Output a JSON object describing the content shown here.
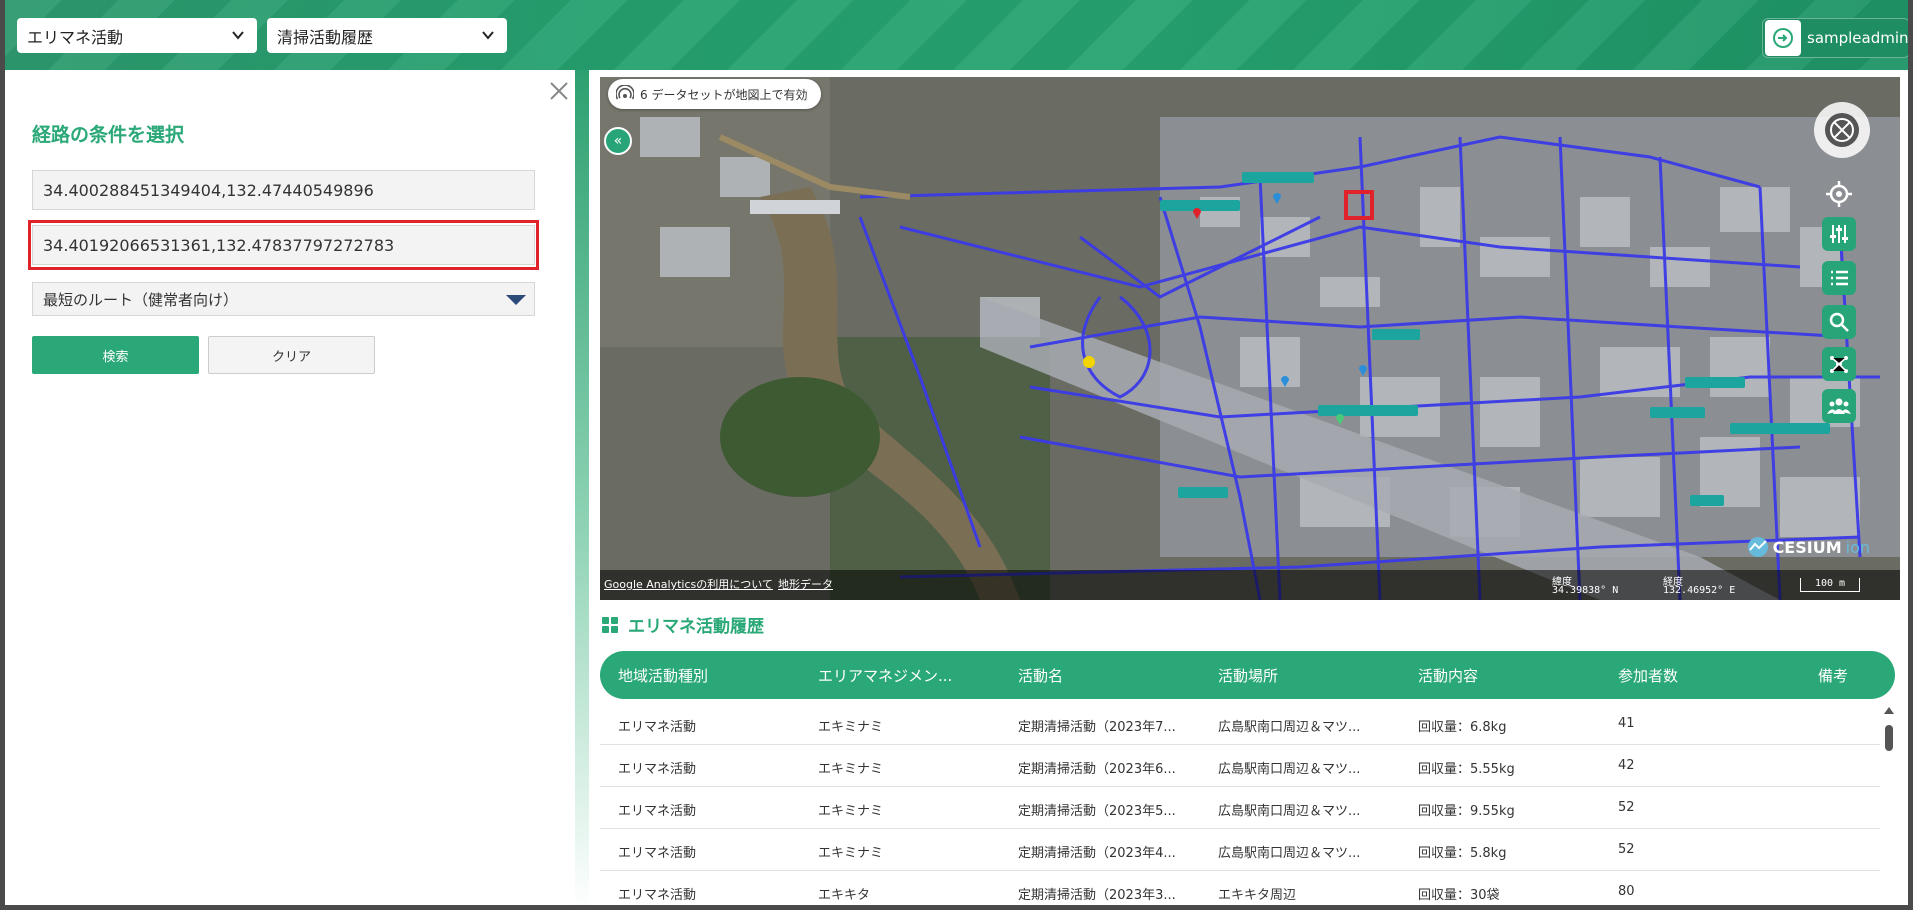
{
  "header": {
    "category_select": "エリマネ活動",
    "history_select": "清掃活動履歴",
    "user_name": "sampleadmin",
    "accent": "#2aa877"
  },
  "route_panel": {
    "title": "経路の条件を選択",
    "start_coord": "34.400288451349404,132.47440549896",
    "end_coord": "34.40192066531361,132.47837797272783",
    "route_type": "最短のルート（健常者向け）",
    "search_label": "検索",
    "clear_label": "クリア"
  },
  "map": {
    "dataset_notice": "6 データセットが地図上で有効",
    "footer_link_analytics": "Google Analyticsの利用について",
    "footer_link_terrain": "地形データ",
    "lat_label": "緯度",
    "lat_value": "34.39838° N",
    "lon_label": "経度",
    "lon_value": "132.46952° E",
    "scale": "100 m",
    "logo": "CESIUM",
    "logo_suffix": "ion"
  },
  "table": {
    "title": "エリマネ活動履歴",
    "columns": [
      "地域活動種別",
      "エリアマネジメン...",
      "活動名",
      "活動場所",
      "活動内容",
      "参加者数",
      "備考"
    ],
    "rows": [
      [
        "エリマネ活動",
        "エキミナミ",
        "定期清掃活動（2023年7...",
        "広島駅南口周辺＆マツ...",
        "回収量：6.8kg",
        "41",
        ""
      ],
      [
        "エリマネ活動",
        "エキミナミ",
        "定期清掃活動（2023年6...",
        "広島駅南口周辺＆マツ...",
        "回収量：5.55kg",
        "42",
        ""
      ],
      [
        "エリマネ活動",
        "エキミナミ",
        "定期清掃活動（2023年5...",
        "広島駅南口周辺＆マツ...",
        "回収量：9.55kg",
        "52",
        ""
      ],
      [
        "エリマネ活動",
        "エキミナミ",
        "定期清掃活動（2023年4...",
        "広島駅南口周辺＆マツ...",
        "回収量：5.8kg",
        "52",
        ""
      ],
      [
        "エリマネ活動",
        "エキキタ",
        "定期清掃活動（2023年3...",
        "エキキタ周辺",
        "回収量：30袋",
        "80",
        ""
      ]
    ]
  }
}
